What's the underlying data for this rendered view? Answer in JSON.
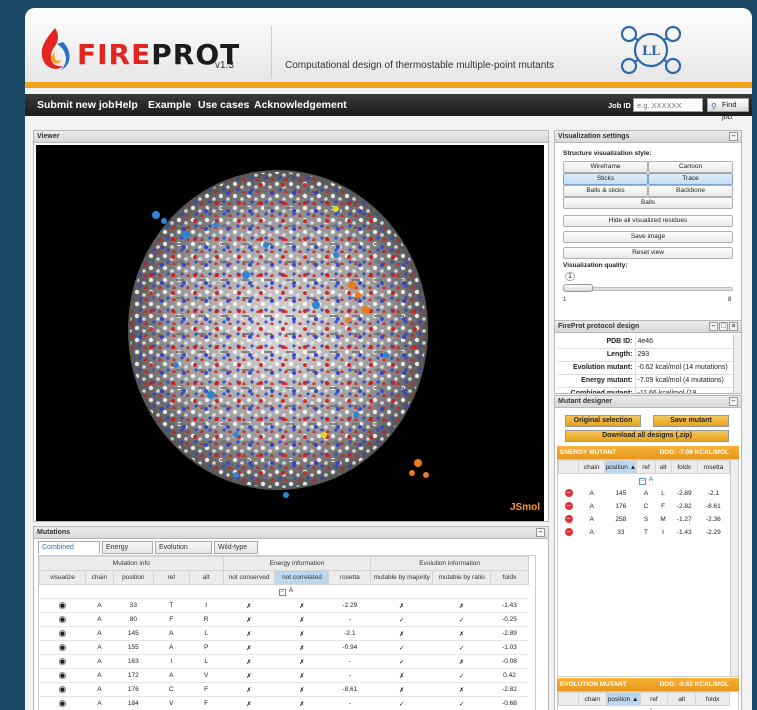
{
  "app": {
    "name_fire": "FIRE",
    "name_prot": "PROT",
    "version": "v1.3",
    "tagline": "Computational design of thermostable multiple-point mutants",
    "partner_logo_text": "LL"
  },
  "nav": {
    "items": [
      "Submit new job",
      "Help",
      "Example",
      "Use cases",
      "Acknowledgement"
    ],
    "job_id_label": "Job ID :",
    "job_id_placeholder": "e.g. XXXXXX",
    "find_job": "Find job"
  },
  "viewer": {
    "title": "Viewer",
    "brand": "JSmol"
  },
  "mutations": {
    "title": "Mutations",
    "tabs": [
      "Combined mutant",
      "Energy mutant",
      "Evolution mutant",
      "Wild-type"
    ],
    "active_tab": "Combined mutant",
    "group_headers": [
      "Mutation info",
      "Energy information",
      "Evolution information"
    ],
    "columns": [
      "visualize",
      "chain",
      "position",
      "ref",
      "alt",
      "not conserved",
      "not correlated",
      "rosetta",
      "mutable by majority",
      "mutable by ratio",
      "foldx"
    ],
    "group_label": "A",
    "rows": [
      {
        "chain": "A",
        "position": "33",
        "ref": "T",
        "alt": "I",
        "nc": "✗",
        "ncor": "✗",
        "rosetta": "-2.29",
        "maj": "✗",
        "ratio": "✗",
        "foldx": "-1.43"
      },
      {
        "chain": "A",
        "position": "80",
        "ref": "F",
        "alt": "R",
        "nc": "✗",
        "ncor": "✗",
        "rosetta": "-",
        "maj": "✓",
        "ratio": "✓",
        "foldx": "-0.25"
      },
      {
        "chain": "A",
        "position": "145",
        "ref": "A",
        "alt": "L",
        "nc": "✗",
        "ncor": "✗",
        "rosetta": "-2.1",
        "maj": "✗",
        "ratio": "✗",
        "foldx": "-2.89"
      },
      {
        "chain": "A",
        "position": "155",
        "ref": "A",
        "alt": "P",
        "nc": "✗",
        "ncor": "✗",
        "rosetta": "-0.94",
        "maj": "✓",
        "ratio": "✓",
        "foldx": "-1.03"
      },
      {
        "chain": "A",
        "position": "163",
        "ref": "I",
        "alt": "L",
        "nc": "✗",
        "ncor": "✗",
        "rosetta": "-",
        "maj": "✓",
        "ratio": "✗",
        "foldx": "-0.08"
      },
      {
        "chain": "A",
        "position": "172",
        "ref": "A",
        "alt": "V",
        "nc": "✗",
        "ncor": "✗",
        "rosetta": "-",
        "maj": "✗",
        "ratio": "✓",
        "foldx": "0.42"
      },
      {
        "chain": "A",
        "position": "176",
        "ref": "C",
        "alt": "F",
        "nc": "✗",
        "ncor": "✗",
        "rosetta": "-8.61",
        "maj": "✗",
        "ratio": "✗",
        "foldx": "-2.82"
      },
      {
        "chain": "A",
        "position": "184",
        "ref": "V",
        "alt": "F",
        "nc": "✗",
        "ncor": "✗",
        "rosetta": "-",
        "maj": "✓",
        "ratio": "✓",
        "foldx": "-0.68"
      }
    ]
  },
  "vis_settings": {
    "title": "Visualization settings",
    "style_label": "Structure visualization style:",
    "styles": [
      "Wireframe",
      "Cartoon",
      "Sticks",
      "Trace",
      "Balls & sticks",
      "Backbone",
      "Balls"
    ],
    "active_styles": [
      "Sticks",
      "Trace"
    ],
    "hide_btn": "Hide all visualized residues",
    "save_image": "Save image",
    "reset_view": "Reset view",
    "quality_label": "Visualization quality:",
    "quality_value": "1",
    "quality_min": "1",
    "quality_max": "8",
    "quality_fraction": 0
  },
  "protocol": {
    "title": "FireProt protocol design",
    "rows": [
      {
        "k": "PDB ID:",
        "v": "4e46"
      },
      {
        "k": "Length:",
        "v": "293"
      },
      {
        "k": "Evolution mutant:",
        "v": "-0.62 kcal/mol (14 mutations)"
      },
      {
        "k": "Energy mutant:",
        "v": "-7.09 kcal/mol (4 mutations)"
      },
      {
        "k": "Combined mutant:",
        "v": "-11.66 kcal/mol (18"
      }
    ]
  },
  "designer": {
    "title": "Mutant designer",
    "original_selection": "Original selection",
    "save_mutant": "Save mutant",
    "download_all": "Download all designs (.zip)",
    "energy": {
      "label": "ENERGY MUTANT",
      "ddg": "DDG: -7.09 KCAL/MOL",
      "columns": [
        "chain",
        "position",
        "ref",
        "alt",
        "foldx",
        "rosetta"
      ],
      "group_label": "A",
      "rows": [
        {
          "chain": "A",
          "position": "145",
          "ref": "A",
          "alt": "L",
          "foldx": "-2.89",
          "rosetta": "-2.1"
        },
        {
          "chain": "A",
          "position": "176",
          "ref": "C",
          "alt": "F",
          "foldx": "-2.82",
          "rosetta": "-8.61"
        },
        {
          "chain": "A",
          "position": "258",
          "ref": "S",
          "alt": "M",
          "foldx": "-1.27",
          "rosetta": "-2.36"
        },
        {
          "chain": "A",
          "position": "33",
          "ref": "T",
          "alt": "I",
          "foldx": "-1.43",
          "rosetta": "-2.29"
        }
      ]
    },
    "evolution": {
      "label": "EVOLUTION MUTANT",
      "ddg": "DDG: -0.62 KCAL/MOL",
      "columns": [
        "chain",
        "position",
        "ref",
        "alt",
        "foldx"
      ],
      "group_label": "A"
    }
  },
  "colors": {
    "accent_orange": "#f2a21a",
    "brand_red": "#e32420",
    "background": "#1e4a6a",
    "selected_blue": "#c6def2"
  }
}
